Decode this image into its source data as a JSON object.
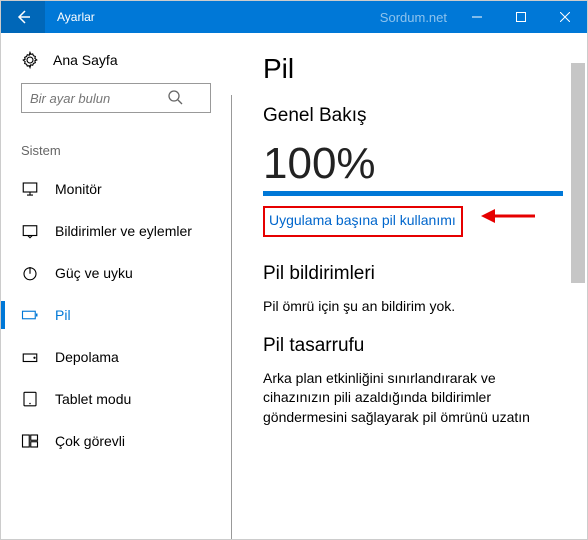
{
  "titlebar": {
    "title": "Ayarlar",
    "watermark": "Sordum.net"
  },
  "sidebar": {
    "home": "Ana Sayfa",
    "search_placeholder": "Bir ayar bulun",
    "section": "Sistem",
    "items": [
      {
        "label": "Monitör"
      },
      {
        "label": "Bildirimler ve eylemler"
      },
      {
        "label": "Güç ve uyku"
      },
      {
        "label": "Pil"
      },
      {
        "label": "Depolama"
      },
      {
        "label": "Tablet modu"
      },
      {
        "label": "Çok görevli"
      }
    ]
  },
  "main": {
    "heading": "Pil",
    "overview": "Genel Bakış",
    "percent": "100%",
    "per_app_link": "Uygulama başına pil kullanımı",
    "notifications_h": "Pil bildirimleri",
    "notifications_body": "Pil ömrü için şu an bildirim yok.",
    "saver_h": "Pil tasarrufu",
    "saver_body": "Arka plan etkinliğini sınırlandırarak ve cihazınızın pili azaldığında bildirimler göndermesini sağlayarak pil ömrünü uzatın"
  }
}
